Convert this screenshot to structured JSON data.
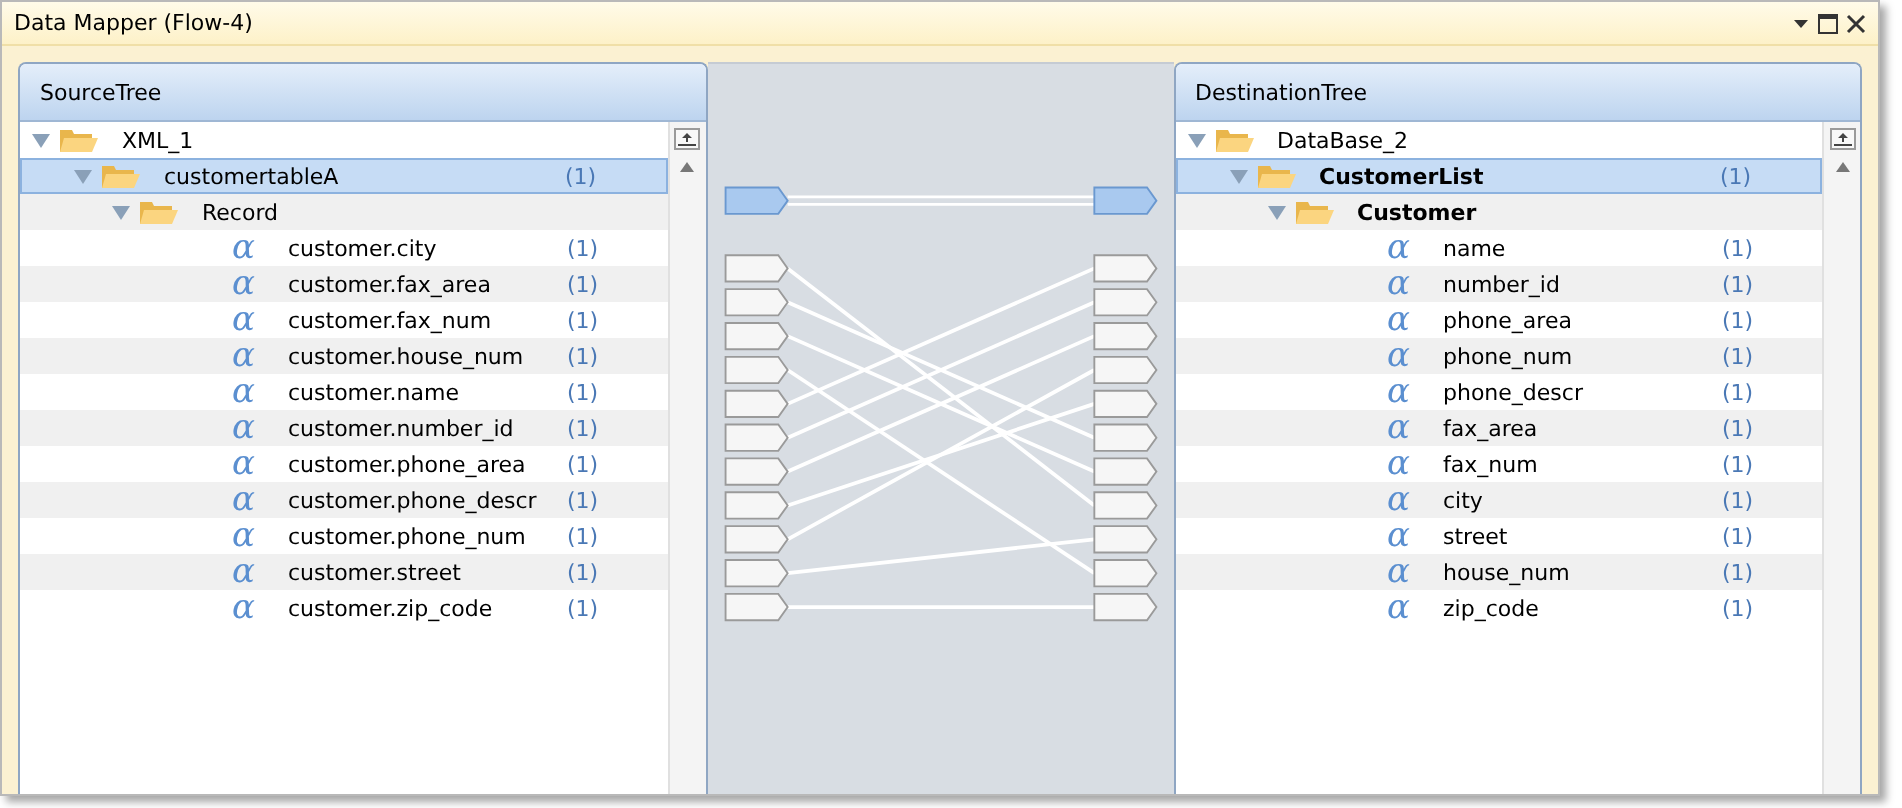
{
  "window": {
    "title": "Data Mapper (Flow-4)"
  },
  "source": {
    "title": "SourceTree",
    "tree": [
      {
        "label": "XML_1",
        "bold": false,
        "selected": false,
        "expanded": true,
        "children": [
          {
            "label": "customertableA",
            "count": "(1)",
            "bold": false,
            "selected": true,
            "expanded": true,
            "children": [
              {
                "label": "Record",
                "bold": false,
                "selected": false,
                "expanded": true,
                "children": [
                  {
                    "icon": "α",
                    "label": "customer.city",
                    "count": "(1)"
                  },
                  {
                    "icon": "α",
                    "label": "customer.fax_area",
                    "count": "(1)"
                  },
                  {
                    "icon": "α",
                    "label": "customer.fax_num",
                    "count": "(1)"
                  },
                  {
                    "icon": "α",
                    "label": "customer.house_num",
                    "count": "(1)"
                  },
                  {
                    "icon": "α",
                    "label": "customer.name",
                    "count": "(1)"
                  },
                  {
                    "icon": "α",
                    "label": "customer.number_id",
                    "count": "(1)"
                  },
                  {
                    "icon": "α",
                    "label": "customer.phone_area",
                    "count": "(1)"
                  },
                  {
                    "icon": "α",
                    "label": "customer.phone_descr",
                    "count": "(1)"
                  },
                  {
                    "icon": "α",
                    "label": "customer.phone_num",
                    "count": "(1)"
                  },
                  {
                    "icon": "α",
                    "label": "customer.street",
                    "count": "(1)"
                  },
                  {
                    "icon": "α",
                    "label": "customer.zip_code",
                    "count": "(1)"
                  }
                ]
              }
            ]
          }
        ]
      }
    ]
  },
  "destination": {
    "title": "DestinationTree",
    "tree": [
      {
        "label": "DataBase_2",
        "bold": false,
        "selected": false,
        "expanded": true,
        "children": [
          {
            "label": "CustomerList",
            "count": "(1)",
            "bold": true,
            "selected": true,
            "expanded": true,
            "children": [
              {
                "label": "Customer",
                "bold": true,
                "selected": false,
                "expanded": true,
                "children": [
                  {
                    "icon": "α",
                    "label": "name",
                    "count": "(1)"
                  },
                  {
                    "icon": "α",
                    "label": "number_id",
                    "count": "(1)"
                  },
                  {
                    "icon": "α",
                    "label": "phone_area",
                    "count": "(1)"
                  },
                  {
                    "icon": "α",
                    "label": "phone_num",
                    "count": "(1)"
                  },
                  {
                    "icon": "α",
                    "label": "phone_descr",
                    "count": "(1)"
                  },
                  {
                    "icon": "α",
                    "label": "fax_area",
                    "count": "(1)"
                  },
                  {
                    "icon": "α",
                    "label": "fax_num",
                    "count": "(1)"
                  },
                  {
                    "icon": "α",
                    "label": "city",
                    "count": "(1)"
                  },
                  {
                    "icon": "α",
                    "label": "street",
                    "count": "(1)"
                  },
                  {
                    "icon": "α",
                    "label": "house_num",
                    "count": "(1)"
                  },
                  {
                    "icon": "α",
                    "label": "zip_code",
                    "count": "(1)"
                  }
                ]
              }
            ]
          }
        ]
      }
    ]
  }
}
